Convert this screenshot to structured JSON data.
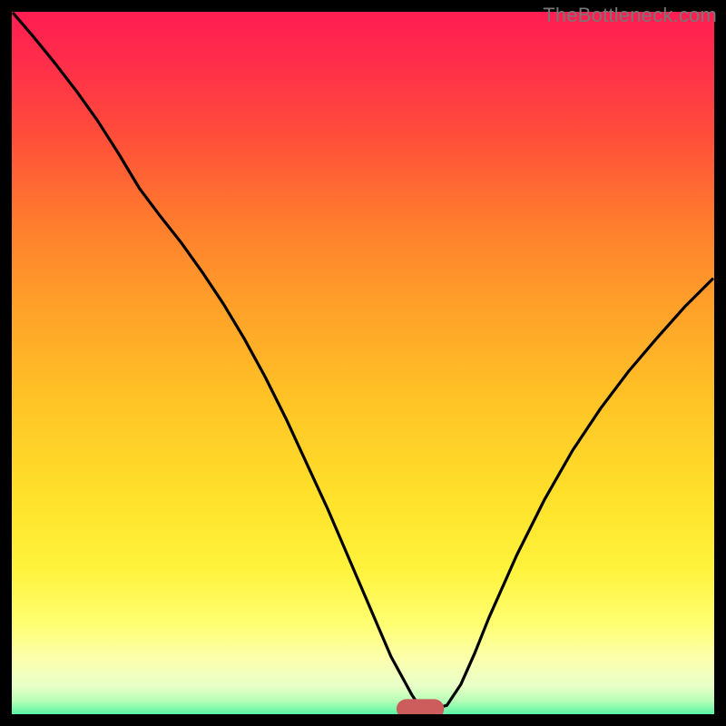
{
  "watermark": "TheBottleneck.com",
  "chart_data": {
    "type": "line",
    "title": "",
    "xlabel": "",
    "ylabel": "",
    "xlim": [
      0,
      100
    ],
    "ylim": [
      0,
      100
    ],
    "x": [
      0,
      3,
      6,
      9,
      12,
      15,
      18,
      21,
      24,
      27,
      30,
      33,
      36,
      39,
      42,
      45,
      48,
      51,
      54,
      57,
      58,
      59,
      60,
      62,
      64,
      66,
      68,
      72,
      76,
      80,
      84,
      88,
      92,
      96,
      100
    ],
    "values": [
      100,
      96.5,
      92.8,
      88.9,
      84.7,
      80.0,
      75.0,
      71.0,
      67.2,
      63.0,
      58.5,
      53.5,
      48.0,
      42.0,
      35.5,
      29.0,
      22.0,
      15.0,
      8.0,
      2.5,
      1.0,
      0.5,
      0.5,
      1.0,
      4.0,
      8.5,
      13.5,
      22.5,
      30.5,
      37.5,
      43.5,
      48.8,
      53.5,
      58.0,
      62.0
    ],
    "gradient_stops": [
      {
        "offset": 0.0,
        "color": "#ff1a54"
      },
      {
        "offset": 0.08,
        "color": "#ff2c4b"
      },
      {
        "offset": 0.18,
        "color": "#ff4b3b"
      },
      {
        "offset": 0.3,
        "color": "#ff7a2e"
      },
      {
        "offset": 0.42,
        "color": "#ffa029"
      },
      {
        "offset": 0.55,
        "color": "#ffc326"
      },
      {
        "offset": 0.68,
        "color": "#ffe02a"
      },
      {
        "offset": 0.78,
        "color": "#fff23a"
      },
      {
        "offset": 0.86,
        "color": "#ffff72"
      },
      {
        "offset": 0.91,
        "color": "#fbffb0"
      },
      {
        "offset": 0.945,
        "color": "#e8ffc8"
      },
      {
        "offset": 0.965,
        "color": "#b8ffb8"
      },
      {
        "offset": 0.98,
        "color": "#6cf7a8"
      },
      {
        "offset": 0.995,
        "color": "#28e796"
      },
      {
        "offset": 1.0,
        "color": "#19dd8d"
      }
    ],
    "marker": {
      "x": 58.2,
      "y": 0.5,
      "width": 6.8,
      "height": 2.8,
      "rx": 1.4,
      "color": "#cd5c5c"
    },
    "frame": {
      "stroke": "#000000",
      "stroke_width": 26
    },
    "line_style": {
      "stroke": "#000000",
      "stroke_width": 3.2
    }
  }
}
